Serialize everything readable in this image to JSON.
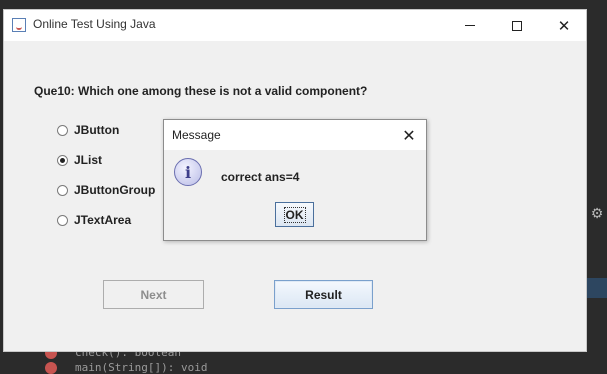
{
  "window": {
    "title": "Online Test Using Java",
    "question": "Que10: Which one among these is not a valid component?",
    "options": [
      {
        "label": "JButton",
        "selected": false
      },
      {
        "label": "JList",
        "selected": true
      },
      {
        "label": "JButtonGroup",
        "selected": false
      },
      {
        "label": "JTextArea",
        "selected": false
      }
    ],
    "next_label": "Next",
    "result_label": "Result",
    "next_enabled": false
  },
  "dialog": {
    "title": "Message",
    "message": "correct ans=4",
    "ok_label": "OK",
    "icon": "information-icon"
  },
  "background": {
    "line1": "check(): boolean",
    "line2": "main(String[]): void"
  }
}
